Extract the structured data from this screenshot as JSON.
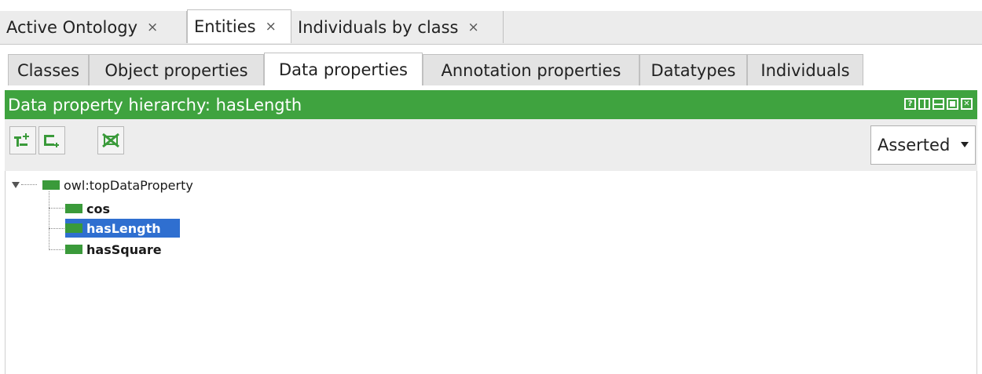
{
  "top_tabs": [
    {
      "label": "Active Ontology",
      "close": "×"
    },
    {
      "label": "Entities",
      "close": "×"
    },
    {
      "label": "Individuals by class",
      "close": "×"
    }
  ],
  "sub_tabs": [
    "Classes",
    "Object properties",
    "Data properties",
    "Annotation properties",
    "Datatypes",
    "Individuals"
  ],
  "view": {
    "title": "Data property hierarchy: hasLength",
    "controls": [
      "help-icon",
      "split-vertical-icon",
      "split-horizontal-icon",
      "maximize-icon",
      "close-view-icon"
    ],
    "accent": "#3fa33f"
  },
  "toolbar": {
    "buttons": [
      "add-sub-property-icon",
      "add-sibling-property-icon",
      "delete-property-icon"
    ],
    "mode": "Asserted"
  },
  "tree": {
    "root": "owl:topDataProperty",
    "children": [
      "cos",
      "hasLength",
      "hasSquare"
    ],
    "selected": "hasLength",
    "selection_color": "#2f6fd0",
    "property_color": "#3a9a3a"
  }
}
